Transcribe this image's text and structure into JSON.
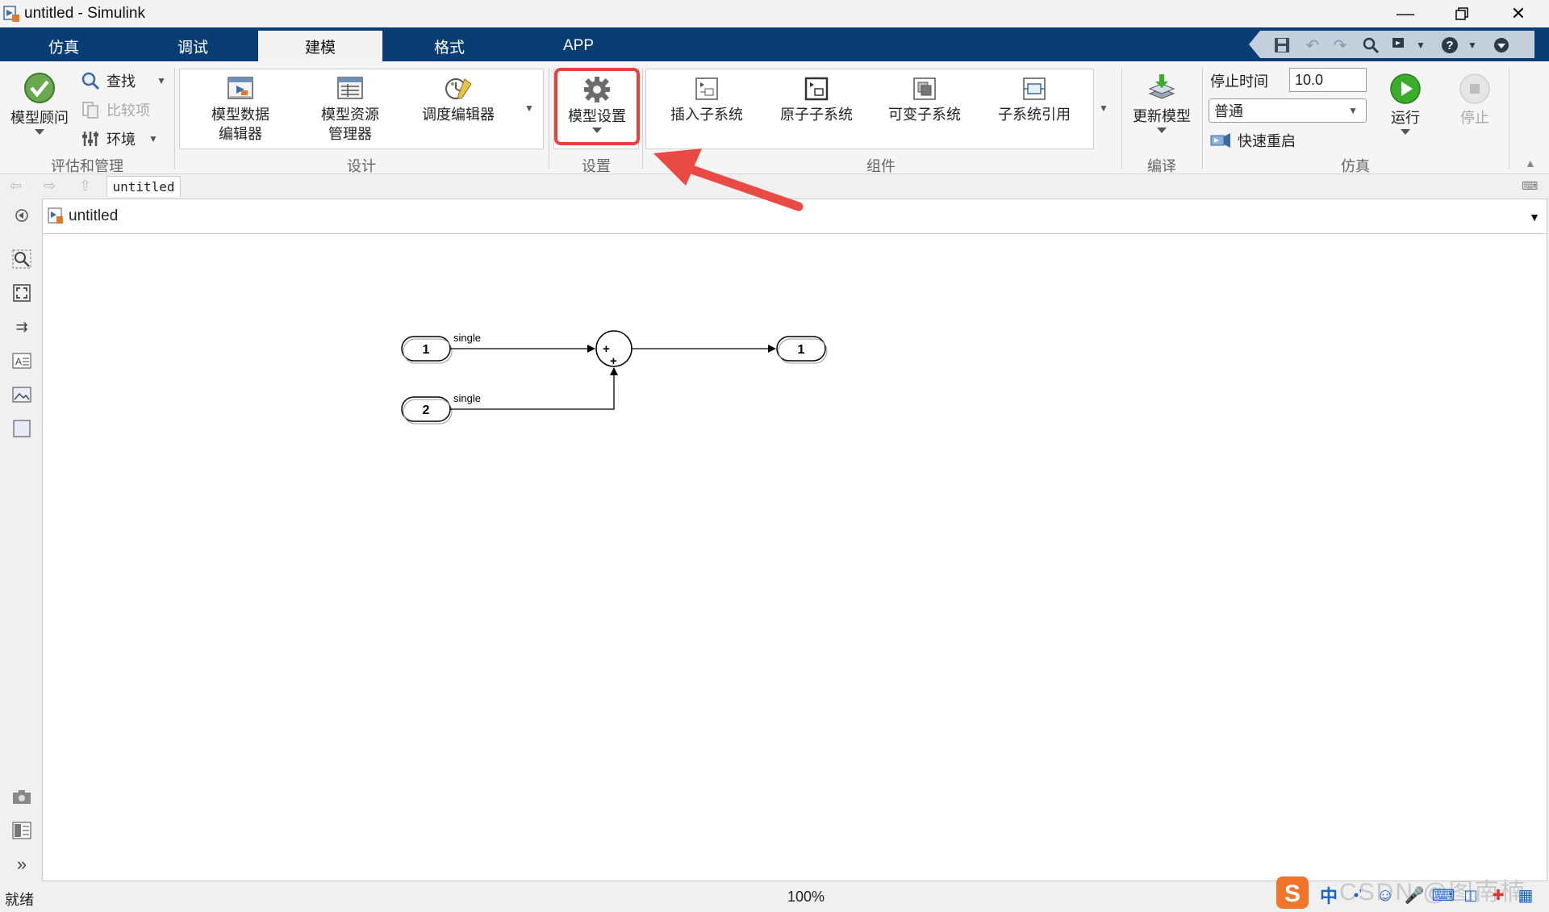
{
  "window": {
    "title": "untitled - Simulink"
  },
  "tabs": [
    "仿真",
    "调试",
    "建模",
    "格式",
    "APP"
  ],
  "active_tab": "建模",
  "toolstrip": {
    "evaluate": {
      "advisor": "模型顾问",
      "find": "查找",
      "compare": "比较项",
      "environment": "环境",
      "section": "评估和管理"
    },
    "design": {
      "data_editor_l1": "模型数据",
      "data_editor_l2": "编辑器",
      "explorer_l1": "模型资源",
      "explorer_l2": "管理器",
      "schedule": "调度编辑器",
      "section": "设计"
    },
    "setup": {
      "model_settings": "模型设置",
      "section": "设置"
    },
    "component": {
      "insert_subsystem": "插入子系统",
      "atomic_subsystem": "原子子系统",
      "variant_subsystem": "可变子系统",
      "subsystem_reference": "子系统引用",
      "section": "组件"
    },
    "compile": {
      "update_model": "更新模型",
      "section": "编译"
    },
    "simulate": {
      "stop_time_label": "停止时间",
      "stop_time_value": "10.0",
      "mode": "普通",
      "fast_restart": "快速重启",
      "run": "运行",
      "stop": "停止",
      "section": "仿真"
    }
  },
  "nav": {
    "crumb": "untitled"
  },
  "pathbar": {
    "model": "untitled"
  },
  "diagram": {
    "inport1": "1",
    "inport2": "2",
    "outport1": "1",
    "signal1": "single",
    "signal2": "single",
    "sum_sign1": "+",
    "sum_sign2": "+"
  },
  "status": {
    "left": "就绪",
    "zoom": "100%"
  },
  "tray": {
    "ime": "中",
    "watermark": "CSDN @图南楠"
  },
  "colors": {
    "tabbar": "#0a3d74",
    "highlight": "#e8413d",
    "run_green": "#3aae2a"
  }
}
